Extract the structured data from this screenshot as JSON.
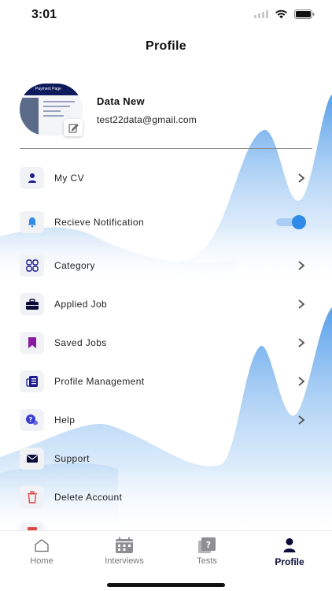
{
  "status_bar": {
    "time": "3:01"
  },
  "header": {
    "title": "Profile"
  },
  "profile": {
    "name": "Data New",
    "email": "test22data@gmail.com",
    "avatar_caption": "Payment Page"
  },
  "menu": [
    {
      "label": "My CV",
      "icon": "person-icon",
      "trailing": "chevron"
    },
    {
      "label": "Recieve Notification",
      "icon": "bell-icon",
      "trailing": "toggle",
      "toggle_on": true
    },
    {
      "label": "Category",
      "icon": "grid-icon",
      "trailing": "chevron"
    },
    {
      "label": "Applied Job",
      "icon": "briefcase-icon",
      "trailing": "chevron"
    },
    {
      "label": "Saved Jobs",
      "icon": "bookmark-icon",
      "trailing": "chevron"
    },
    {
      "label": "Profile Management",
      "icon": "profile-management-icon",
      "trailing": "chevron"
    },
    {
      "label": "Help",
      "icon": "help-chat-icon",
      "trailing": "chevron"
    },
    {
      "label": "Support",
      "icon": "mail-icon",
      "trailing": "none"
    },
    {
      "label": "Delete Account",
      "icon": "trash-icon",
      "trailing": "none"
    }
  ],
  "tabs": [
    {
      "label": "Home",
      "icon": "home-icon",
      "active": false
    },
    {
      "label": "Interviews",
      "icon": "calendar-icon",
      "active": false
    },
    {
      "label": "Tests",
      "icon": "tests-icon",
      "active": false
    },
    {
      "label": "Profile",
      "icon": "profile-icon",
      "active": true
    }
  ],
  "colors": {
    "accent": "#2e8be8",
    "navy": "#0b0b3a",
    "wave": "#5aa3ec",
    "delete": "#e04646",
    "bookmark": "#8a1aa0"
  }
}
